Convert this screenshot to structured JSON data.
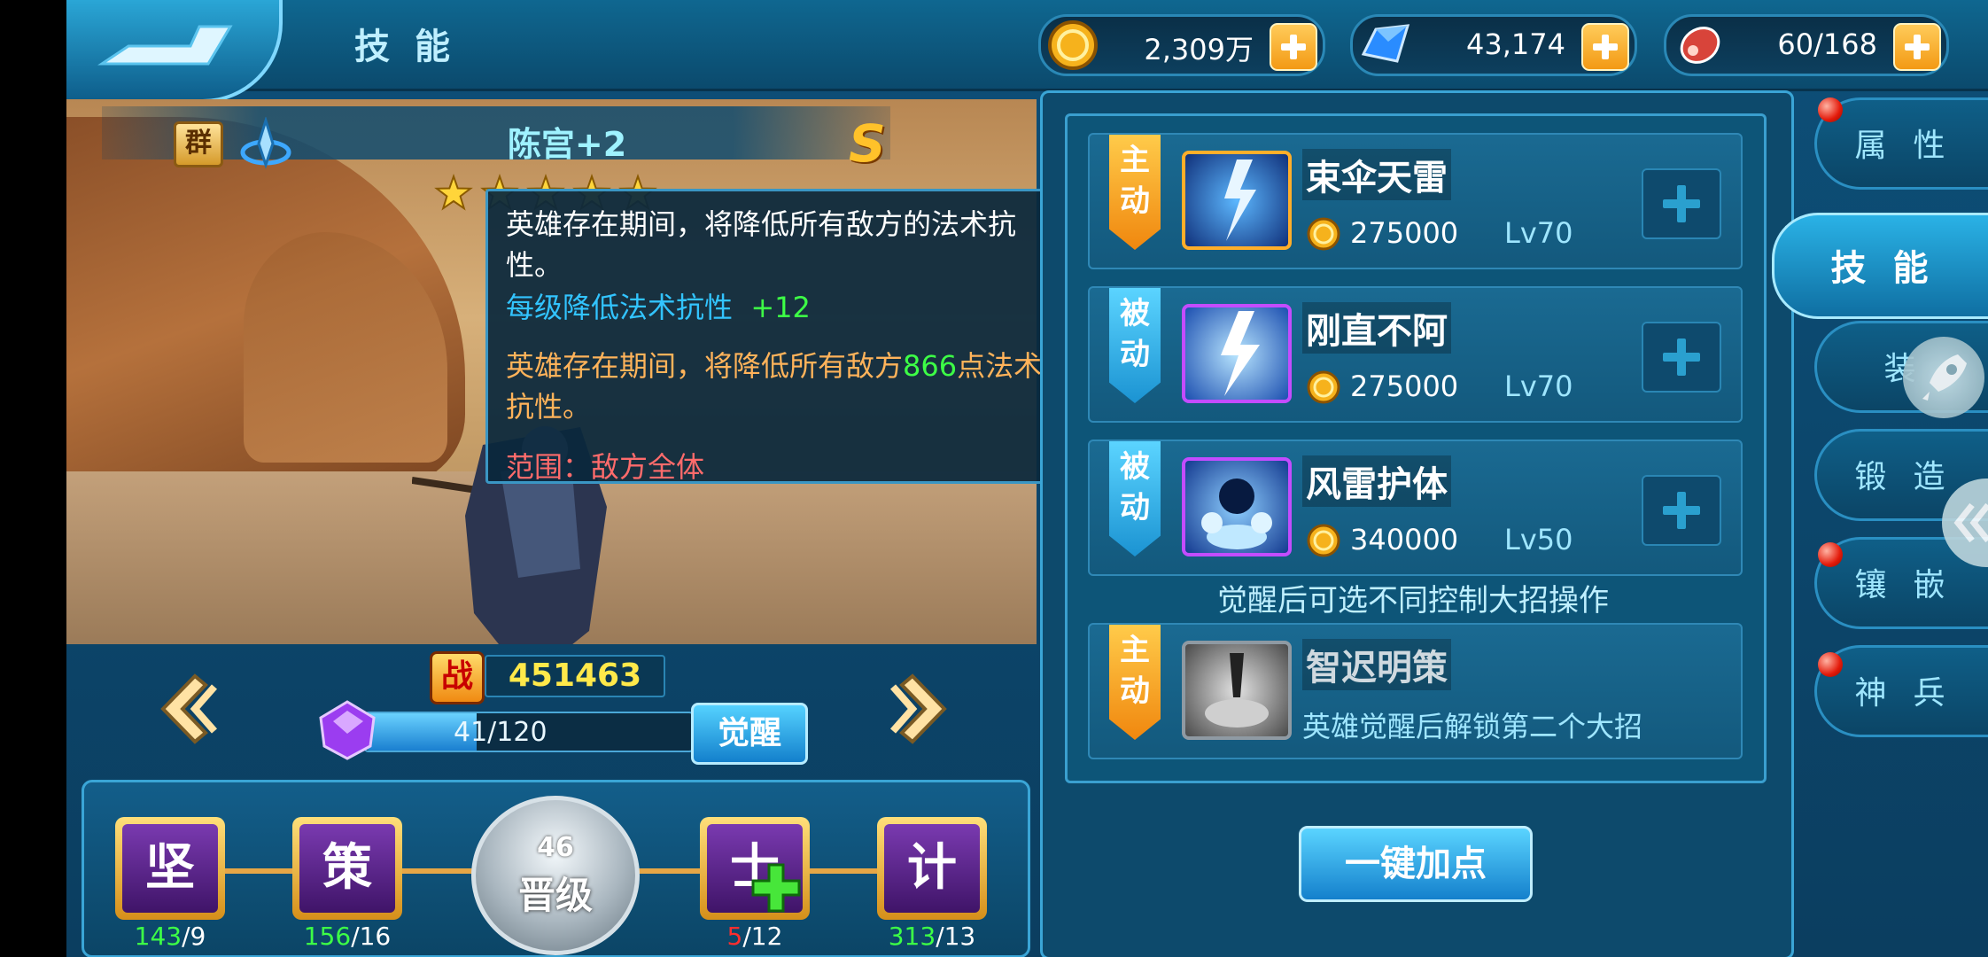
{
  "header": {
    "title": "技能",
    "resources": [
      {
        "icon": "gold-coin-icon",
        "value": "2,309万"
      },
      {
        "icon": "diamond-icon",
        "value": "43,174"
      },
      {
        "icon": "meat-stamina-icon",
        "value": "60/168"
      }
    ]
  },
  "hero": {
    "camp": "群",
    "name": "陈宫+2",
    "grade": "S",
    "stars": 5,
    "power_label": "战",
    "power": "451463",
    "exp_text": "41/120",
    "exp_fraction": 0.34,
    "awaken_label": "觉醒"
  },
  "tooltip": {
    "line1": "英雄存在期间，将降低所有敌方的法术抗性。",
    "line2_label": "每级降低法术抗性",
    "line2_value": "+12",
    "line3_prefix": "英雄存在期间，将降低所有敌方",
    "line3_value": "866",
    "line3_suffix": "点法术抗性。",
    "line4": "范围：敌方全体"
  },
  "talents": {
    "nodes": [
      {
        "label": "坚",
        "current": "143",
        "max": "/9",
        "current_color": "green"
      },
      {
        "label": "策",
        "current": "156",
        "max": "/16",
        "current_color": "green"
      },
      {
        "label": "士",
        "current": "5",
        "max": "/12",
        "current_color": "red"
      },
      {
        "label": "计",
        "current": "313",
        "max": "/13",
        "current_color": "green"
      }
    ],
    "promote_level": "46",
    "promote_label": "晋级"
  },
  "skills": [
    {
      "type": "主动",
      "name": "束伞天雷",
      "cost": "275000",
      "level": "Lv70"
    },
    {
      "type": "被动",
      "name": "刚直不阿",
      "cost": "275000",
      "level": "Lv70"
    },
    {
      "type": "被动",
      "name": "风雷护体",
      "cost": "340000",
      "level": "Lv50"
    }
  ],
  "awaken_hint": "觉醒后可选不同控制大招操作",
  "awaken_skill": {
    "type": "主动",
    "name": "智迟明策",
    "desc": "英雄觉醒后解锁第二个大招"
  },
  "one_key_label": "一键加点",
  "side_tabs": [
    {
      "label": "属性",
      "dot": true
    },
    {
      "label": "技能",
      "active": true
    },
    {
      "label": "装",
      "dot": false
    },
    {
      "label": "锻造",
      "dot": false
    },
    {
      "label": "镶嵌",
      "dot": true
    },
    {
      "label": "神兵",
      "dot": true
    }
  ]
}
